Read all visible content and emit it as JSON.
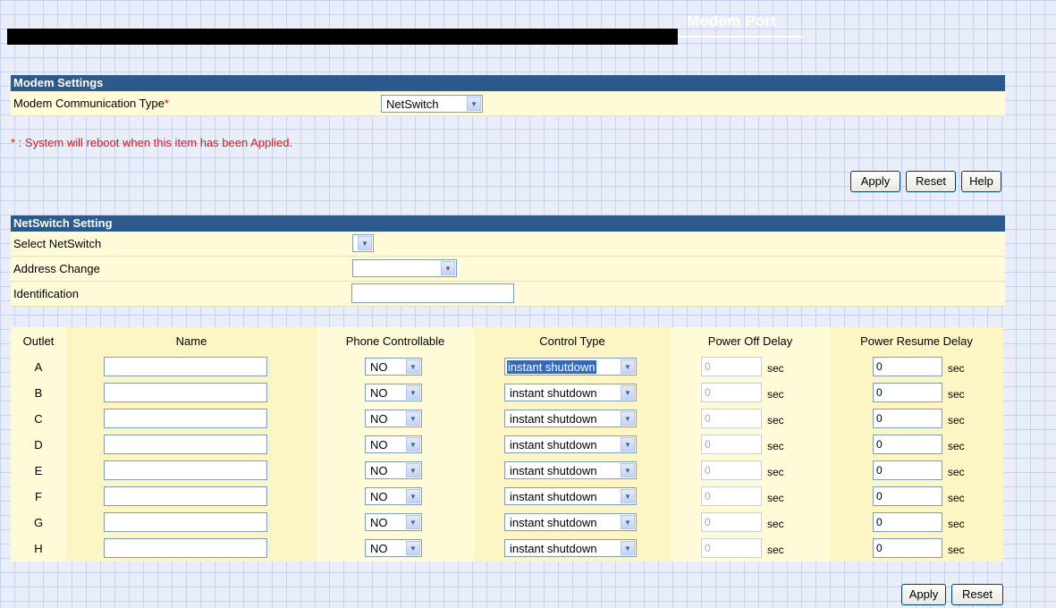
{
  "header": {
    "title": "Modem Port"
  },
  "modem_settings": {
    "heading": "Modem Settings",
    "comm_type_label": "Modem Communication Type",
    "required_mark": "*",
    "comm_type_value": "NetSwitch"
  },
  "note": "* : System will reboot when this item has been Applied.",
  "top_buttons": {
    "apply": "Apply",
    "reset": "Reset",
    "help": "Help"
  },
  "netswitch": {
    "heading": "NetSwitch Setting",
    "select_label": "Select NetSwitch",
    "select_value": "",
    "address_label": "Address Change",
    "address_value": "",
    "ident_label": "Identification",
    "ident_value": ""
  },
  "outlet_table": {
    "headers": [
      "Outlet",
      "Name",
      "Phone Controllable",
      "Control Type",
      "Power Off Delay",
      "Power Resume Delay"
    ],
    "sec_unit": "sec",
    "rows": [
      {
        "outlet": "A",
        "name": "",
        "phone": "NO",
        "control": "instant shutdown",
        "off_delay": "0",
        "resume_delay": "0"
      },
      {
        "outlet": "B",
        "name": "",
        "phone": "NO",
        "control": "instant shutdown",
        "off_delay": "0",
        "resume_delay": "0"
      },
      {
        "outlet": "C",
        "name": "",
        "phone": "NO",
        "control": "instant shutdown",
        "off_delay": "0",
        "resume_delay": "0"
      },
      {
        "outlet": "D",
        "name": "",
        "phone": "NO",
        "control": "instant shutdown",
        "off_delay": "0",
        "resume_delay": "0"
      },
      {
        "outlet": "E",
        "name": "",
        "phone": "NO",
        "control": "instant shutdown",
        "off_delay": "0",
        "resume_delay": "0"
      },
      {
        "outlet": "F",
        "name": "",
        "phone": "NO",
        "control": "instant shutdown",
        "off_delay": "0",
        "resume_delay": "0"
      },
      {
        "outlet": "G",
        "name": "",
        "phone": "NO",
        "control": "instant shutdown",
        "off_delay": "0",
        "resume_delay": "0"
      },
      {
        "outlet": "H",
        "name": "",
        "phone": "NO",
        "control": "instant shutdown",
        "off_delay": "0",
        "resume_delay": "0"
      }
    ]
  },
  "bottom_buttons": {
    "apply": "Apply",
    "reset": "Reset"
  },
  "icons": {
    "dropdown": "chevron-down-icon"
  },
  "colors": {
    "section_header": "#2c5a8c",
    "row_bg": "#fffbd9",
    "note": "#e01818",
    "selected_bg": "#316ac5"
  }
}
